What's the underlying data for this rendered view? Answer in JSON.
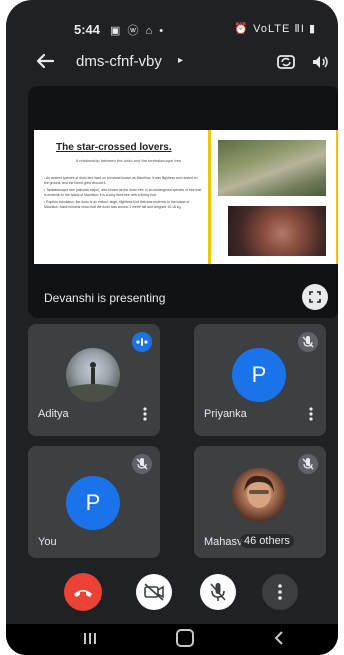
{
  "status_bar": {
    "time": "5:44",
    "left_icons": "▣ ⓦ ⌂ •",
    "right_icons": "⏰ VoLTE ⅡI ▮"
  },
  "topbar": {
    "meeting_code": "dms-cfnf-vby",
    "chevron": "▸"
  },
  "presentation": {
    "presenter_label": "Devanshi is presenting",
    "slide": {
      "title": "The star-crossed lovers.",
      "subtitle": "A relationship between the dodo and the tambalacoque tree.",
      "body": [
        "• An ancient species of dodo bird lived on an island known as Mauritius; it was flightless and nested on the ground, and the forest grew around it.",
        "• Tambalacoque tree (calvaria major), also known as the dodo tree, is an endangered species of tree that is endemic to the island of Mauritius; it is a long lived tree with a fleshy fruit.",
        "• Raphus cucullatus: the dodo is an extinct, large, flightless bird that was endemic to the island of Mauritius; fossil remains show that the dodo was around 1 metre tall and weighed 10-18 kg."
      ]
    }
  },
  "participants": [
    {
      "name": "Aditya",
      "avatar": "photo",
      "status": "speaking"
    },
    {
      "name": "Priyanka",
      "avatar": "P",
      "status": "muted"
    },
    {
      "name": "You",
      "avatar": "P",
      "status": "muted"
    },
    {
      "name": "Mahasv",
      "avatar": "photo",
      "status": "muted",
      "others_label": "46 others"
    }
  ],
  "controls": {
    "end_call": "end-call",
    "camera": "camera-off",
    "microphone": "mic-off",
    "more": "more-options"
  },
  "colors": {
    "background": "#202124",
    "tile": "#3c4043",
    "accent_blue": "#1a73e8",
    "end_call_red": "#ea4335",
    "slide_accent_yellow": "#f5c300"
  }
}
